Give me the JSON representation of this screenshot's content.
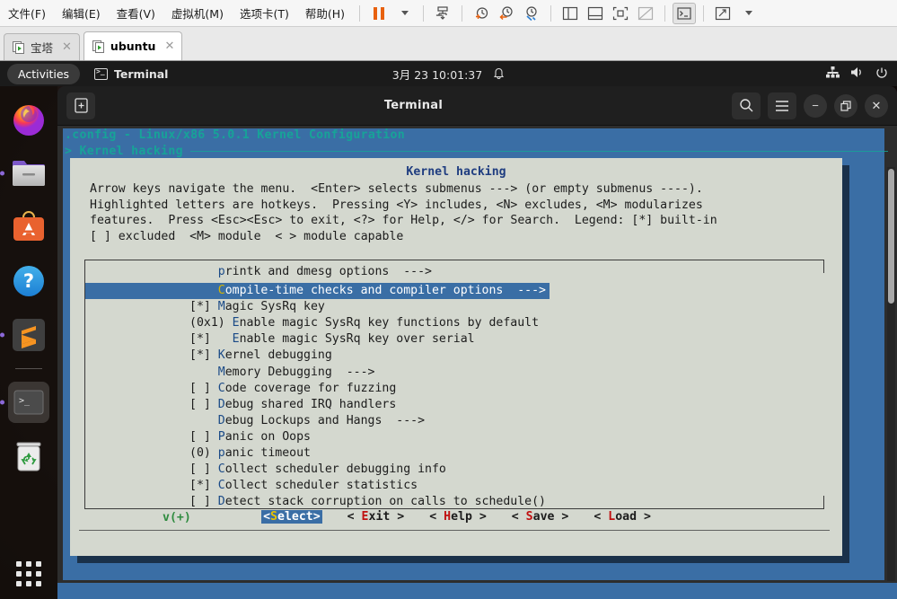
{
  "vmware": {
    "menus": [
      {
        "label": "文件(F)",
        "accel": "F"
      },
      {
        "label": "编辑(E)",
        "accel": "E"
      },
      {
        "label": "查看(V)",
        "accel": "V"
      },
      {
        "label": "虚拟机(M)",
        "accel": "M"
      },
      {
        "label": "选项卡(T)",
        "accel": "T"
      },
      {
        "label": "帮助(H)",
        "accel": "H"
      }
    ],
    "toolbar_icons": [
      "pause-icon",
      "dropdown-caret-icon",
      "snapshot-manager-icon",
      "take-snapshot-icon",
      "revert-snapshot-icon",
      "manage-snapshots-icon",
      "show-sidebar-icon",
      "show-console-icon",
      "fullscreen-icon",
      "unity-mode-icon",
      "terminal-icon",
      "expand-icon",
      "expand-caret-icon"
    ],
    "tabs": [
      {
        "label": "宝塔",
        "active": false,
        "close": "✕"
      },
      {
        "label": "ubuntu",
        "active": true,
        "close": "✕"
      }
    ]
  },
  "gnome": {
    "activities": "Activities",
    "app_name": "Terminal",
    "app_icon": "terminal-icon",
    "clock": "3月 23  10:01:37",
    "notification_icon": "bell-icon",
    "tray_icons": [
      "network-icon",
      "volume-icon",
      "power-icon"
    ]
  },
  "dock": {
    "items": [
      {
        "name": "firefox",
        "label": "Firefox",
        "running": false,
        "active": false
      },
      {
        "name": "files",
        "label": "Files",
        "running": true,
        "active": false
      },
      {
        "name": "ubuntu-software",
        "label": "Ubuntu Software",
        "running": false,
        "active": false
      },
      {
        "name": "help",
        "label": "Help",
        "running": false,
        "active": false
      },
      {
        "name": "sublime-text",
        "label": "Sublime Text",
        "running": true,
        "active": false
      },
      {
        "name": "terminal",
        "label": "Terminal",
        "running": true,
        "active": true
      },
      {
        "name": "trash",
        "label": "Trash",
        "running": false,
        "active": false
      }
    ],
    "show_apps_label": "Show Applications"
  },
  "window": {
    "title": "Terminal",
    "new_tab_icon": "new-tab-icon",
    "search_icon": "search-icon",
    "menu_icon": "hamburger-menu-icon",
    "minimize": "−",
    "maximize": "❐",
    "close": "✕"
  },
  "menuconfig": {
    "header": ".config - Linux/x86 5.0.1 Kernel Configuration",
    "breadcrumb": "> Kernel hacking",
    "dialog_title": "Kernel hacking",
    "help_lines": [
      "Arrow keys navigate the menu.  <Enter> selects submenus ---> (or empty submenus ----).",
      "Highlighted letters are hotkeys.  Pressing <Y> includes, <N> excludes, <M> modularizes",
      "features.  Press <Esc><Esc> to exit, <?> for Help, </> for Search.  Legend: [*] built-in",
      "[ ] excluded  <M> module  < > module capable"
    ],
    "items": [
      {
        "marker": "    ",
        "hotkey": "p",
        "pre": "",
        "post": "rintk and dmesg options  --->",
        "selected": false
      },
      {
        "marker": "    ",
        "hotkey": "C",
        "pre": "",
        "post": "ompile-time checks and compiler options  --->",
        "selected": true
      },
      {
        "marker": "[*] ",
        "hotkey": "M",
        "pre": "",
        "post": "agic SysRq key",
        "selected": false
      },
      {
        "marker": "(0x1) ",
        "hotkey": "E",
        "pre": "",
        "post": "nable magic SysRq key functions by default",
        "selected": false
      },
      {
        "marker": "[*]   ",
        "hotkey": "E",
        "pre": "",
        "post": "nable magic SysRq key over serial",
        "selected": false
      },
      {
        "marker": "[*] ",
        "hotkey": "K",
        "pre": "",
        "post": "ernel debugging",
        "selected": false
      },
      {
        "marker": "    ",
        "hotkey": "M",
        "pre": "",
        "post": "emory Debugging  --->",
        "selected": false
      },
      {
        "marker": "[ ] ",
        "hotkey": "C",
        "pre": "",
        "post": "ode coverage for fuzzing",
        "selected": false
      },
      {
        "marker": "[ ] ",
        "hotkey": "D",
        "pre": "",
        "post": "ebug shared IRQ handlers",
        "selected": false
      },
      {
        "marker": "    ",
        "hotkey": "D",
        "pre": "",
        "post": "ebug Lockups and Hangs  --->",
        "selected": false
      },
      {
        "marker": "[ ] ",
        "hotkey": "P",
        "pre": "",
        "post": "anic on Oops",
        "selected": false
      },
      {
        "marker": "(0) ",
        "hotkey": "p",
        "pre": "",
        "post": "anic timeout",
        "selected": false
      },
      {
        "marker": "[ ] ",
        "hotkey": "C",
        "pre": "",
        "post": "ollect scheduler debugging info",
        "selected": false
      },
      {
        "marker": "[*] ",
        "hotkey": "C",
        "pre": "",
        "post": "ollect scheduler statistics",
        "selected": false
      },
      {
        "marker": "[ ] ",
        "hotkey": "D",
        "pre": "",
        "post": "etect stack corruption on calls to schedule()",
        "selected": false
      }
    ],
    "scroll_indicator": "v(+)",
    "buttons": [
      {
        "open": "<",
        "hotkey": "S",
        "rest": "elect",
        "close": ">",
        "selected": true
      },
      {
        "open": "< ",
        "hotkey": "E",
        "rest": "xit",
        "close": " >",
        "selected": false
      },
      {
        "open": "< ",
        "hotkey": "H",
        "rest": "elp",
        "close": " >",
        "selected": false
      },
      {
        "open": "< ",
        "hotkey": "S",
        "rest": "ave",
        "close": " >",
        "selected": false
      },
      {
        "open": "< ",
        "hotkey": "L",
        "rest": "oad",
        "close": " >",
        "selected": false
      }
    ]
  },
  "colors": {
    "menuconfig_blue": "#3a6ea5",
    "dialog_bg": "#d4d8cf",
    "header_teal": "#17a398",
    "hotkey_blue": "#1a4a87",
    "hotkey_selected": "#d7b600",
    "hotkey_button_red": "#c01010",
    "scroll_green": "#2e8b3f"
  }
}
